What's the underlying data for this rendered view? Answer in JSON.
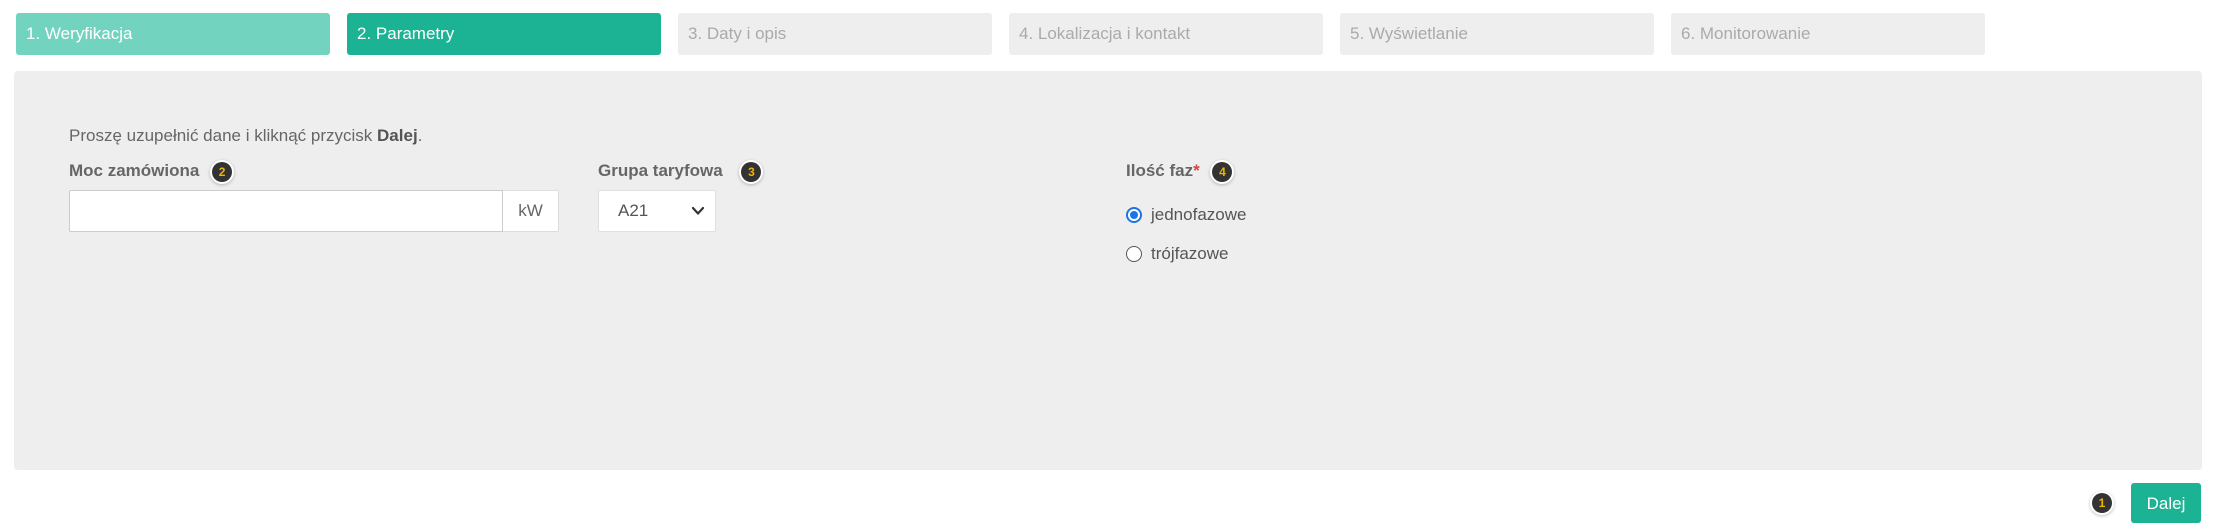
{
  "steps": [
    {
      "label": "1. Weryfikacja",
      "state": "done"
    },
    {
      "label": "2. Parametry",
      "state": "active"
    },
    {
      "label": "3. Daty i opis",
      "state": "pending"
    },
    {
      "label": "4. Lokalizacja i kontakt",
      "state": "pending"
    },
    {
      "label": "5. Wyświetlanie",
      "state": "pending"
    },
    {
      "label": "6. Monitorowanie",
      "state": "pending"
    }
  ],
  "form": {
    "intro_text": "Proszę uzupełnić dane i kliknąć przycisk ",
    "intro_bold": "Dalej",
    "intro_end": ".",
    "power": {
      "label": "Moc zamówiona",
      "badge": "2",
      "value": "",
      "unit": "kW"
    },
    "tariff": {
      "label": "Grupa taryfowa",
      "badge": "3",
      "selected": "A21"
    },
    "phases": {
      "label": "Ilość faz",
      "required_mark": "*",
      "badge": "4",
      "options": [
        {
          "label": "jednofazowe",
          "checked": true
        },
        {
          "label": "trójfazowe",
          "checked": false
        }
      ]
    }
  },
  "footer": {
    "badge": "1",
    "next_label": "Dalej"
  },
  "colors": {
    "accent": "#1bb394",
    "done": "#72d3bf",
    "pending": "#eeeeee",
    "radio": "#1a73e8",
    "required": "#e04040"
  }
}
